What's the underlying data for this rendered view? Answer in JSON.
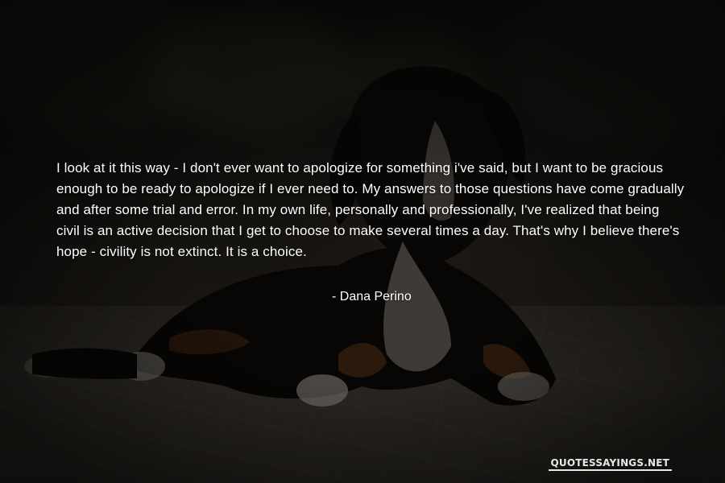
{
  "quote": {
    "text": "I look at it this way - I don't ever want to apologize for something i've said, but I want to be gracious enough to be ready to apologize if I ever need to. My answers to those questions have come gradually and after some trial and error. In my own life, personally and professionally, I've realized that being civil is an active decision that I get to choose to make several times a day. That's why I believe there's hope - civility is not extinct. It is a choice.",
    "author": "- Dana Perino"
  },
  "watermark": {
    "text": "QUOTESSAYINGS.NET"
  },
  "colors": {
    "text": "#ffffff",
    "background": "#1a1714"
  }
}
